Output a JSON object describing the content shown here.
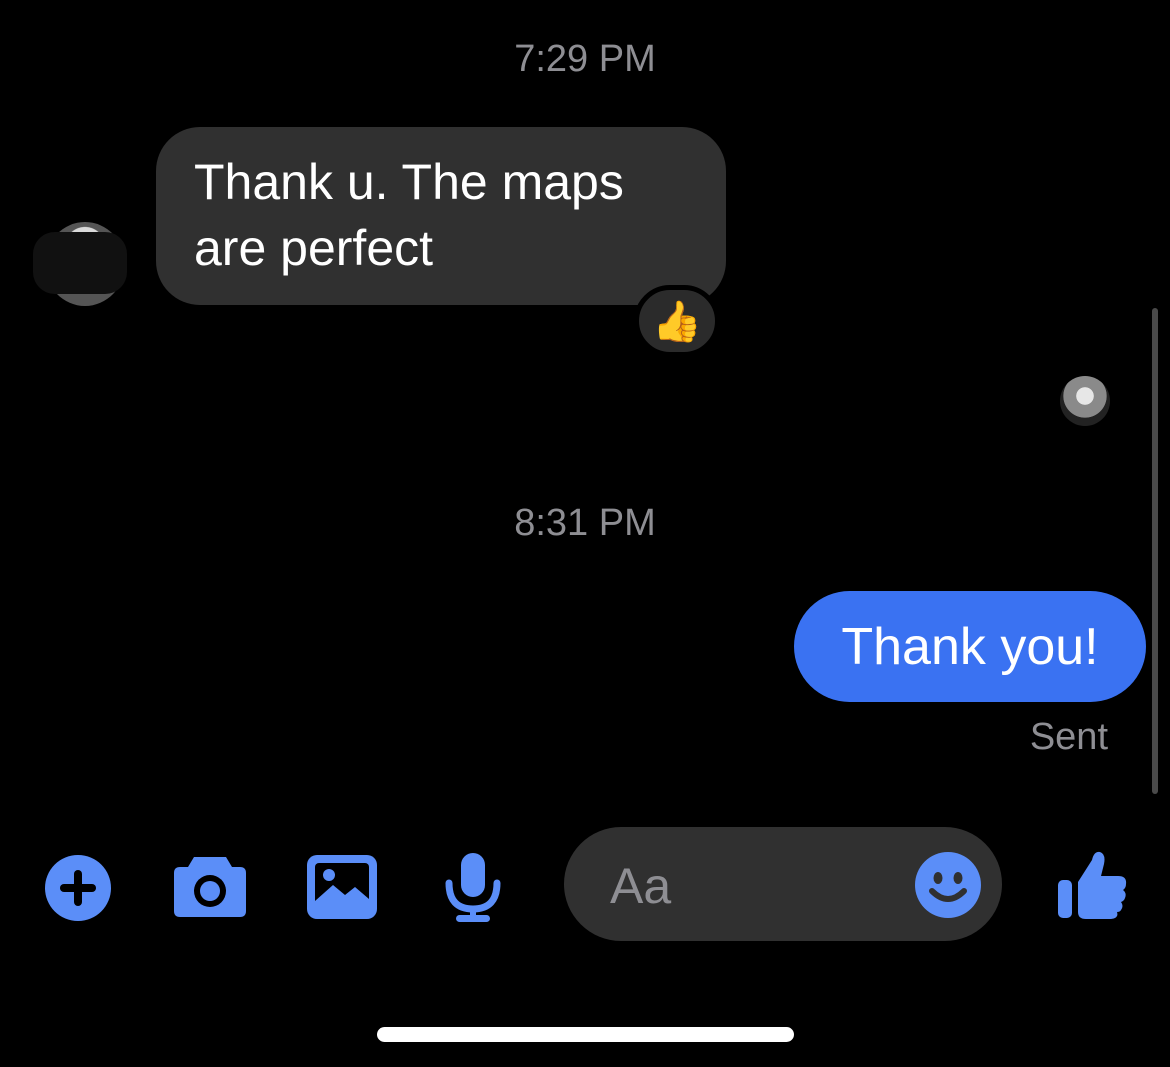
{
  "conversation": {
    "timestamps": [
      "7:29 PM",
      "8:31 PM"
    ],
    "incoming_message": {
      "text_line1": "Thank u. The maps",
      "text_line2": "are perfect",
      "reaction": "👍"
    },
    "outgoing_message": {
      "text": "Thank you!",
      "status": "Sent"
    }
  },
  "composer": {
    "placeholder": "Aa"
  },
  "toolbar": {
    "icons": [
      "plus-icon",
      "camera-icon",
      "gallery-icon",
      "microphone-icon",
      "emoji-icon",
      "thumbs-up-icon"
    ]
  },
  "colors": {
    "accent": "#3a72f2",
    "icon_blue": "#5b8ef8",
    "incoming_bubble": "#303030",
    "background": "#000000",
    "muted_text": "#8e8e93"
  }
}
